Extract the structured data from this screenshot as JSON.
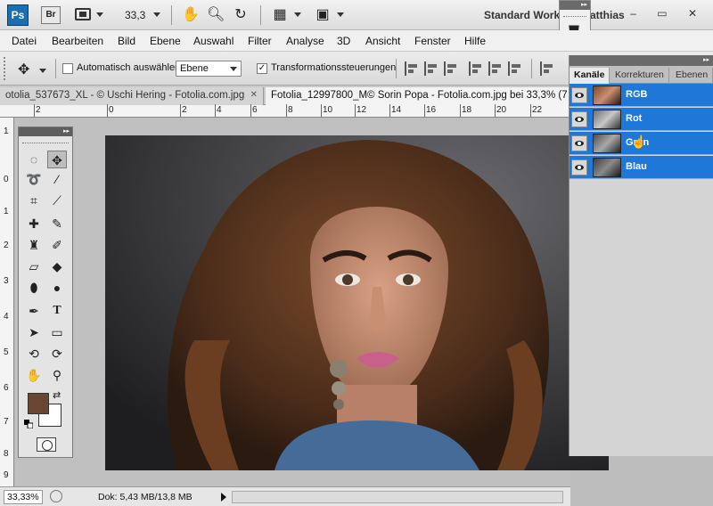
{
  "app": {
    "logo": "Ps",
    "bridge": "Br",
    "zoom_display": "33,3",
    "workspace": "Standard Work",
    "user_name": "atthias",
    "window_controls": "–  ▭  ✕"
  },
  "menu": [
    "Datei",
    "Bearbeiten",
    "Bild",
    "Ebene",
    "Auswahl",
    "Filter",
    "Analyse",
    "3D",
    "Ansicht",
    "Fenster",
    "Hilfe"
  ],
  "options": {
    "auto_select_label": "Automatisch auswählen:",
    "auto_select_checked": false,
    "auto_select_target": "Ebene",
    "transform_label": "Transformationssteuerungen",
    "transform_checked": true
  },
  "tabs": [
    {
      "label": "otolia_537673_XL - © Uschi Hering - Fotolia.com.jpg",
      "active": false
    },
    {
      "label": "Fotolia_12997800_M© Sorin Popa - Fotolia.com.jpg bei 33,3% (7",
      "active": true
    }
  ],
  "rulers": {
    "top": [
      "2",
      "0",
      "2",
      "4",
      "6",
      "8",
      "10",
      "12",
      "14",
      "16",
      "18",
      "20",
      "22"
    ],
    "left": [
      "1",
      "0",
      "1",
      "2",
      "3",
      "4",
      "5",
      "6",
      "7",
      "8",
      "9"
    ]
  },
  "status": {
    "zoom": "33,33%",
    "doc_info": "Dok: 5,43 MB/13,8 MB"
  },
  "colors": {
    "foreground": "#6b4534",
    "background": "#ffffff",
    "selection_blue": "#1f78d8"
  },
  "channels_panel": {
    "tabs": [
      "Kanäle",
      "Korrekturen",
      "Ebenen"
    ],
    "channels": [
      {
        "name": "RGB",
        "selected": true
      },
      {
        "name": "Rot",
        "selected": true
      },
      {
        "name": "Grün",
        "selected": true
      },
      {
        "name": "Blau",
        "selected": true
      }
    ]
  },
  "tools": [
    "marquee",
    "move",
    "lasso",
    "magic-wand",
    "crop",
    "eyedropper",
    "healing",
    "brush",
    "clone-stamp",
    "history-brush",
    "eraser",
    "paint-bucket",
    "blur",
    "dodge",
    "pen",
    "type",
    "path-select",
    "shape",
    "3d-rotate",
    "3d-orbit",
    "hand",
    "zoom"
  ]
}
